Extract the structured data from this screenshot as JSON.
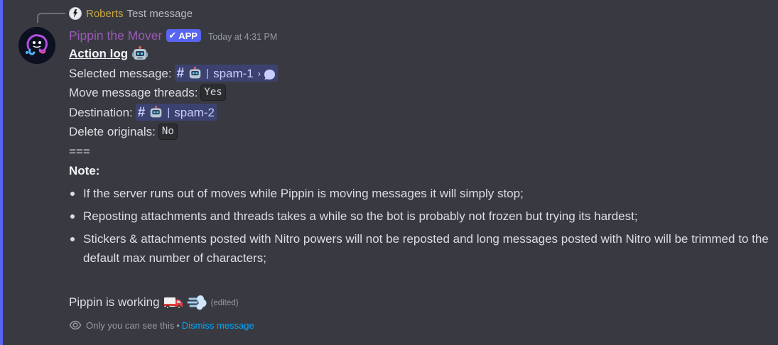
{
  "reply": {
    "author": "Roberts",
    "text": "Test message",
    "icon": "user-avatar-icon"
  },
  "message": {
    "author": "Pippin the Mover",
    "author_color": "#9b59b6",
    "badge": "APP",
    "badge_check": "✔",
    "timestamp": "Today at 4:31 PM",
    "accent_color": "#5865f2"
  },
  "action_log": {
    "title": "Action log",
    "selected_label": "Selected message:",
    "selected_channel": "spam-1",
    "move_threads_label": "Move message threads:",
    "move_threads_value": "Yes",
    "destination_label": "Destination:",
    "destination_channel": "spam-2",
    "delete_label": "Delete originals:",
    "delete_value": "No",
    "separator": "===",
    "note_label": "Note:",
    "notes": [
      "If the server runs out of moves while Pippin is moving messages it will simply stop;",
      "Reposting attachments and threads takes a while so the bot is probably not frozen but trying its hardest;",
      "Stickers & attachments posted with Nitro powers will not be reposted and long messages posted with Nitro will be trimmed to the default max number of characters;"
    ],
    "status": "Pippin is working",
    "edited": "(edited)"
  },
  "mention": {
    "hash": "#",
    "pipe": "|",
    "chevron": "›"
  },
  "footer": {
    "ephemeral_text": "Only you can see this",
    "dot": "•",
    "dismiss": "Dismiss message"
  }
}
